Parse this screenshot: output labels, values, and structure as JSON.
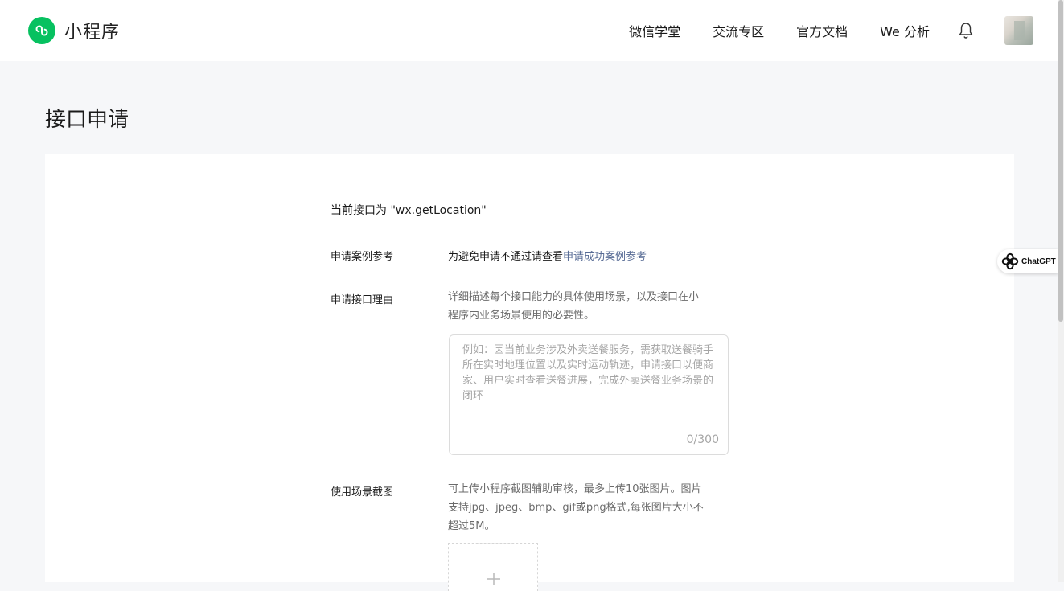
{
  "header": {
    "logo_text": "小程序",
    "nav": [
      "微信学堂",
      "交流专区",
      "官方文档",
      "We 分析"
    ]
  },
  "page": {
    "title": "接口申请"
  },
  "form": {
    "current_api": "当前接口为 \"wx.getLocation\"",
    "case_label": "申请案例参考",
    "case_text": "为避免申请不通过请查看",
    "case_link": "申请成功案例参考",
    "reason_label": "申请接口理由",
    "reason_hint_line1": "详细描述每个接口能力的具体使用场景，以及接口在小",
    "reason_hint_line2": "程序内业务场景使用的必要性。",
    "reason_placeholder": "例如：因当前业务涉及外卖送餐服务，需获取送餐骑手所在实时地理位置以及实时运动轨迹，申请接口以便商家、用户实时查看送餐进展，完成外卖送餐业务场景的闭环",
    "reason_counter": "0/300",
    "screenshot_label": "使用场景截图",
    "screenshot_hint_line1": "可上传小程序截图辅助审核，最多上传10张图片。图片",
    "screenshot_hint_line2": "支持jpg、jpeg、bmp、gif或png格式,每张图片大小不",
    "screenshot_hint_line3": "超过5M。"
  },
  "extension_badge": {
    "label": "ChatGPT"
  },
  "colors": {
    "brand_green": "#07c160",
    "link_blue": "#576b95",
    "page_bg": "#f6f7f9"
  }
}
